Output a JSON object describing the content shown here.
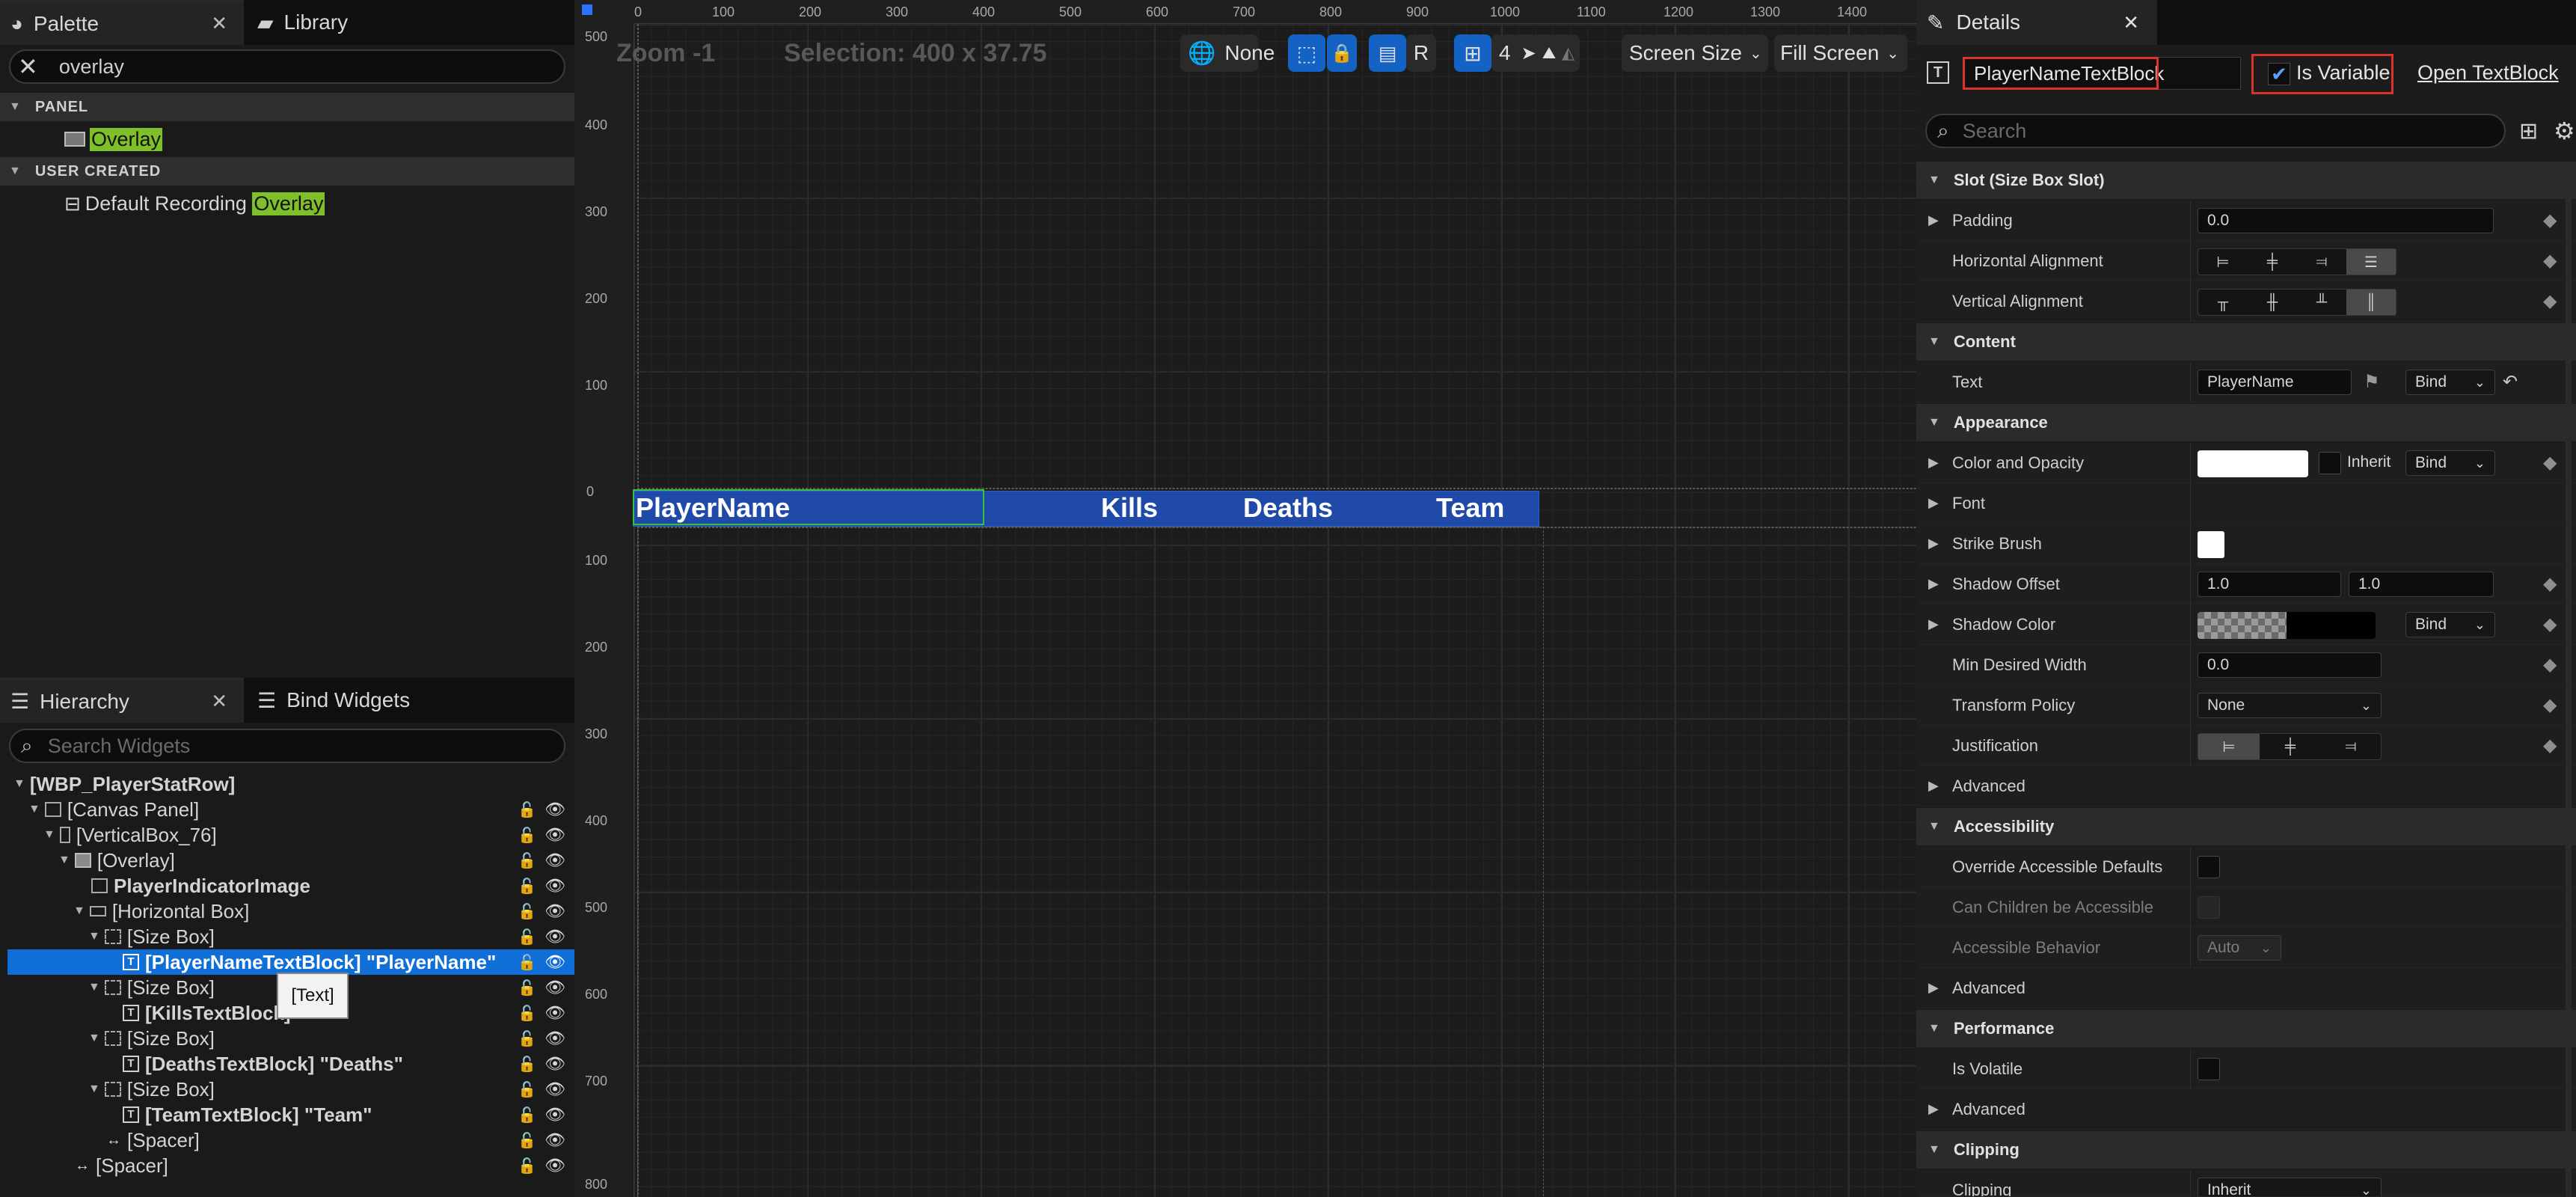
{
  "palette": {
    "tab_palette": "Palette",
    "tab_library": "Library",
    "search_value": "overlay",
    "category_panel": "PANEL",
    "item_overlay": "Overlay",
    "category_user": "USER CREATED",
    "item_default_prefix": "Default Recording ",
    "item_default_match": "Overlay"
  },
  "hierarchy": {
    "tab_hierarchy": "Hierarchy",
    "tab_bind": "Bind Widgets",
    "search_placeholder": "Search Widgets",
    "rows": [
      "[WBP_PlayerStatRow]",
      "[Canvas Panel]",
      "[VerticalBox_76]",
      "[Overlay]",
      "PlayerIndicatorImage",
      "[Horizontal Box]",
      "[Size Box]",
      "[PlayerNameTextBlock] \"PlayerName\"",
      "[Size Box]",
      "[KillsTextBlock]",
      "[Size Box]",
      "[DeathsTextBlock] \"Deaths\"",
      "[Size Box]",
      "[TeamTextBlock] \"Team\"",
      "[Spacer]",
      "[Spacer]"
    ],
    "tooltip": "[Text]"
  },
  "designer": {
    "zoom": "Zoom -1",
    "selection": "Selection: 400 x 37.75",
    "none_label": "None",
    "r_label": "R",
    "grid_value": "4",
    "screen_size": "Screen Size",
    "fill_screen": "Fill Screen",
    "ruler_x": [
      "0",
      "100",
      "200",
      "300",
      "400",
      "500",
      "600",
      "700",
      "800",
      "900",
      "1000",
      "1100",
      "1200",
      "1300",
      "1400"
    ],
    "ruler_y": [
      "500",
      "400",
      "300",
      "200",
      "100",
      "0",
      "100",
      "200",
      "300",
      "400",
      "500",
      "600",
      "700",
      "800"
    ],
    "cols": {
      "player": "PlayerName",
      "kills": "Kills",
      "deaths": "Deaths",
      "team": "Team"
    }
  },
  "details": {
    "tab": "Details",
    "widget_name": "PlayerNameTextBlock",
    "is_variable": "Is Variable",
    "open": "Open TextBlock",
    "search_placeholder": "Search",
    "sec_slot": "Slot (Size Box Slot)",
    "padding": "Padding",
    "padding_val": "0.0",
    "halign": "Horizontal Alignment",
    "valign": "Vertical Alignment",
    "sec_content": "Content",
    "text": "Text",
    "text_val": "PlayerName",
    "bind": "Bind",
    "sec_appearance": "Appearance",
    "color_opacity": "Color and Opacity",
    "inherit": "Inherit",
    "font": "Font",
    "strike": "Strike Brush",
    "shadow_offset": "Shadow Offset",
    "so_x": "1.0",
    "so_y": "1.0",
    "shadow_color": "Shadow Color",
    "min_width": "Min Desired Width",
    "min_width_val": "0.0",
    "transform": "Transform Policy",
    "transform_val": "None",
    "justification": "Justification",
    "advanced": "Advanced",
    "sec_access": "Accessibility",
    "override": "Override Accessible Defaults",
    "children": "Can Children be Accessible",
    "behavior": "Accessible Behavior",
    "behavior_val": "Auto",
    "sec_perf": "Performance",
    "volatile": "Is Volatile",
    "sec_clip": "Clipping",
    "clipping": "Clipping",
    "clipping_val": "Inherit"
  }
}
